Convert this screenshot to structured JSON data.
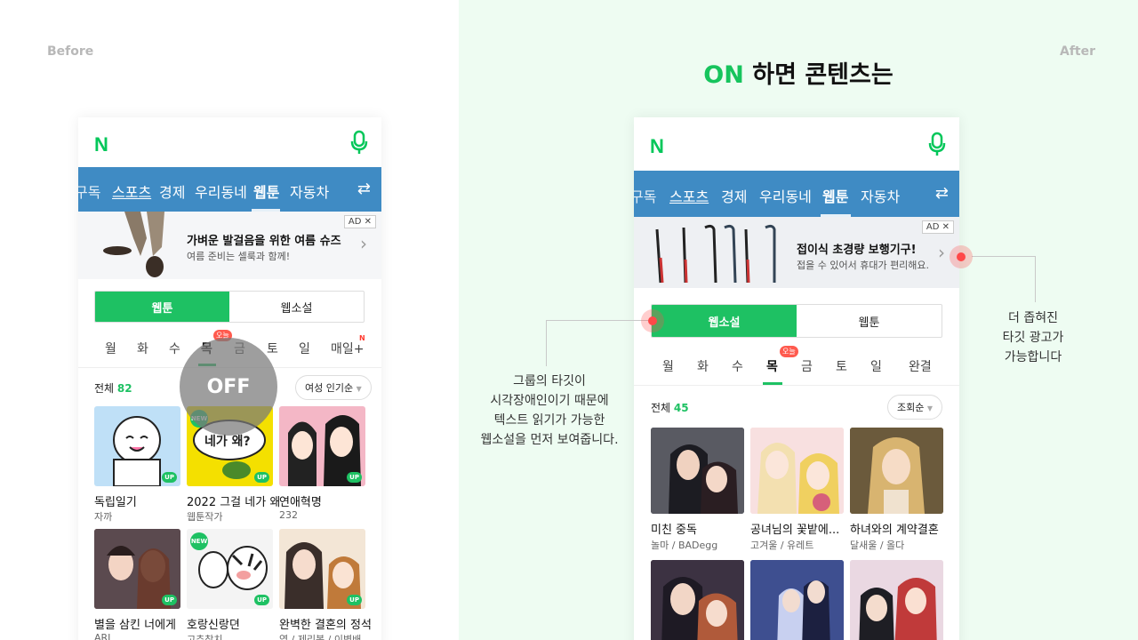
{
  "labels": {
    "before": "Before",
    "after": "After"
  },
  "headline": {
    "on": "ON",
    "rest": " 하면 콘텐츠는"
  },
  "before": {
    "logo": "N",
    "nav": [
      "구독",
      "스포츠",
      "경제",
      "우리동네",
      "웹툰",
      "자동차"
    ],
    "ad": {
      "badge": "AD ✕",
      "title": "가벼운 발걸음을 위한 여름 슈즈",
      "sub": "여름 준비는 셀룩과 함께!"
    },
    "tabs": [
      "웹툰",
      "웹소설"
    ],
    "days": [
      "월",
      "화",
      "수",
      "목",
      "금",
      "토",
      "일",
      "매일+"
    ],
    "today_badge": "오늘",
    "new_mark": "N",
    "count_label": "전체",
    "count": "82",
    "sort": "여성 인기순",
    "off": "OFF",
    "items": [
      {
        "title": "독립일기",
        "author": "자까",
        "badge": "UP"
      },
      {
        "title": "2022 그걸 네가 왜!",
        "author": "웹툰작가",
        "badge": "UP",
        "new": "NEW",
        "art_text": "네가 왜?"
      },
      {
        "title": "연애혁명",
        "author": "232",
        "badge": "UP"
      },
      {
        "title": "별을 삼킨 너에게",
        "author": "ARI",
        "badge": "UP"
      },
      {
        "title": "호랑신랑뎐",
        "author": "고추참치",
        "badge": "UP",
        "new": "NEW"
      },
      {
        "title": "완벽한 결혼의 정석",
        "author": "염 / 제리봉 / 이병배",
        "badge": "UP"
      }
    ]
  },
  "after": {
    "logo": "N",
    "nav": [
      "구독",
      "스포츠",
      "경제",
      "우리동네",
      "웹툰",
      "자동차"
    ],
    "ad": {
      "badge": "AD ✕",
      "title": "접이식 초경량 보행기구!",
      "sub": "접을 수 있어서 휴대가 편리해요."
    },
    "tabs": [
      "웹소설",
      "웹툰"
    ],
    "days": [
      "월",
      "화",
      "수",
      "목",
      "금",
      "토",
      "일",
      "완결"
    ],
    "today_badge": "오늘",
    "count_label": "전체",
    "count": "45",
    "sort": "조회순",
    "items": [
      {
        "title": "미친 중독",
        "author": "놀마 / BADegg"
      },
      {
        "title": "공녀님의 꽃밭에...",
        "author": "고겨울 / 유레트"
      },
      {
        "title": "하녀와의 계약결혼",
        "author": "달새울 / 올다"
      }
    ]
  },
  "callouts": {
    "left": [
      "그룹의 타깃이",
      "시각장애인이기 때문에",
      "텍스트 읽기가 가능한",
      "웹소설을 먼저 보여줍니다."
    ],
    "right": [
      "더 좁혀진",
      "타깃 광고가",
      "가능합니다"
    ]
  }
}
